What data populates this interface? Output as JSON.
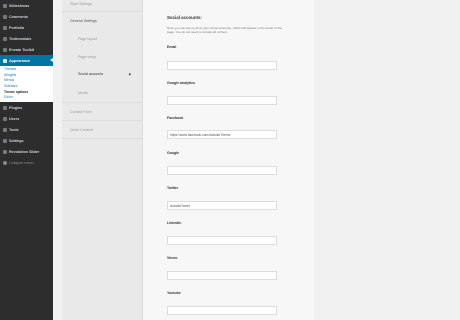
{
  "sidebar": {
    "items": [
      {
        "label": "Slideshows",
        "icon": "slideshow-icon"
      },
      {
        "label": "Comments",
        "icon": "comments-icon"
      },
      {
        "label": "Portfolio",
        "icon": "portfolio-icon"
      },
      {
        "label": "Testimonials",
        "icon": "testimonials-icon"
      },
      {
        "label": "Envato Toolkit",
        "icon": "toolkit-icon"
      },
      {
        "label": "Appearance",
        "icon": "appearance-icon"
      }
    ],
    "appearance_submenu": [
      "Themes",
      "Widgets",
      "Menus",
      "Sidebars",
      "Theme options",
      "Editor"
    ],
    "items_after": [
      {
        "label": "Plugins",
        "icon": "plugins-icon"
      },
      {
        "label": "Users",
        "icon": "users-icon"
      },
      {
        "label": "Tools",
        "icon": "tools-icon"
      },
      {
        "label": "Settings",
        "icon": "settings-icon"
      },
      {
        "label": "Revolution Slider",
        "icon": "slider-icon"
      }
    ],
    "collapse_label": "Collapse menu"
  },
  "tabs": {
    "style_settings": "Style Settings",
    "general_settings": "General Settings",
    "page_layout": "Page layout",
    "page_setup": "Page setup",
    "social_accounts": "Social accounts",
    "media": "Media",
    "contact_form": "Contact Form",
    "quick_content": "Quick Content"
  },
  "panel": {
    "title": "Social accounts:",
    "description": "Here you can set up all of your social accounts, which will appear in the footer of the page. You do not need to include all of them.",
    "fields": [
      {
        "label": "Email",
        "value": ""
      },
      {
        "label": "Google analytics",
        "value": ""
      },
      {
        "label": "Facebook",
        "value": "https://www.facebook.com/AstudioTheme"
      },
      {
        "label": "Google",
        "value": ""
      },
      {
        "label": "Twitter",
        "value": "AstudioTweet"
      },
      {
        "label": "LinkedIn",
        "value": ""
      },
      {
        "label": "Vimeo",
        "value": ""
      },
      {
        "label": "Youtube",
        "value": ""
      }
    ]
  }
}
